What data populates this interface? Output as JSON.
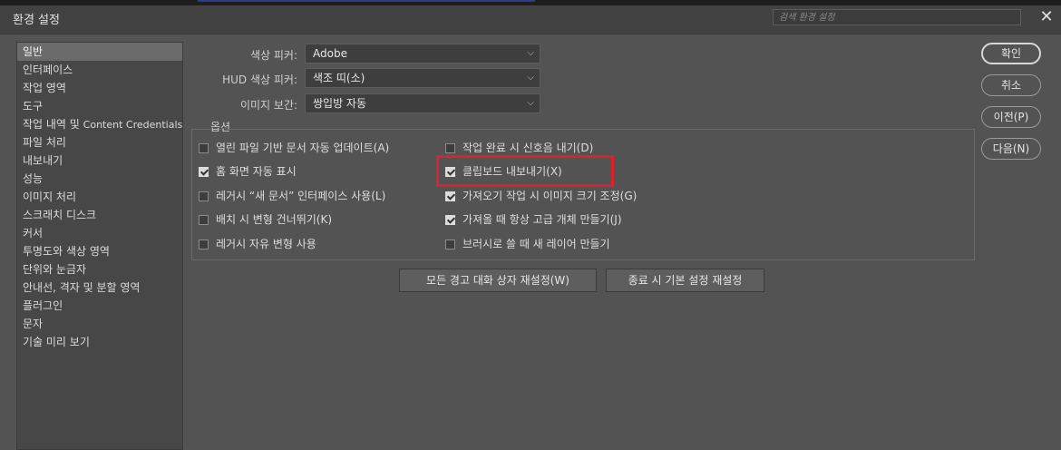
{
  "window": {
    "title": "환경 설정",
    "search_placeholder": "검색 환경 설정",
    "close_glyph": "✕"
  },
  "sidebar": {
    "items": [
      {
        "label": "일반",
        "selected": true
      },
      {
        "label": "인터페이스"
      },
      {
        "label": "작업 영역"
      },
      {
        "label": "도구"
      },
      {
        "label": "작업 내역 및 ",
        "latin": "Content Credentials"
      },
      {
        "label": "파일 처리"
      },
      {
        "label": "내보내기"
      },
      {
        "label": "성능"
      },
      {
        "label": "이미지 처리"
      },
      {
        "label": "스크래치 디스크"
      },
      {
        "label": "커서"
      },
      {
        "label": "투명도와 색상 영역"
      },
      {
        "label": "단위와 눈금자"
      },
      {
        "label": "안내선, 격자 및 분할 영역"
      },
      {
        "label": "플러그인"
      },
      {
        "label": "문자"
      },
      {
        "label": "기술 미리 보기"
      }
    ]
  },
  "fields": {
    "color_picker": {
      "label": "색상 피커:",
      "value": "Adobe"
    },
    "hud_picker": {
      "label": "HUD 색상 피커:",
      "value": "색조 띠(소)"
    },
    "interpolation": {
      "label": "이미지 보간:",
      "value": "쌍입방 자동"
    }
  },
  "options": {
    "title": "옵션",
    "left": [
      {
        "label": "열린 파일 기반 문서 자동 업데이트(A)",
        "checked": false
      },
      {
        "label": "홈 화면 자동 표시",
        "checked": true
      },
      {
        "label": "레거시 “새 문서” 인터페이스 사용(L)",
        "checked": false
      },
      {
        "label": "배치 시 변형 건너뛰기(K)",
        "checked": false
      },
      {
        "label": "레거시 자유 변형 사용",
        "checked": false
      }
    ],
    "right": [
      {
        "label": "작업 완료 시 신호음 내기(D)",
        "checked": false
      },
      {
        "label": "클립보드 내보내기(X)",
        "checked": true
      },
      {
        "label": "가져오기 작업 시 이미지 크기 조정(G)",
        "checked": true
      },
      {
        "label": "가져올 때 항상 고급 개체 만들기(J)",
        "checked": true
      },
      {
        "label": "브러시로 쓸 때 새 레이어 만들기",
        "checked": false
      }
    ]
  },
  "buttons": {
    "reset_warnings": "모든 경고 대화 상자 재설정(W)",
    "reset_on_quit": "종료 시 기본 설정 재설정",
    "ok": "확인",
    "cancel": "취소",
    "prev": "이전(P)",
    "next": "다음(N)"
  },
  "colors": {
    "highlight": "#e0202a",
    "background": "#535353"
  }
}
